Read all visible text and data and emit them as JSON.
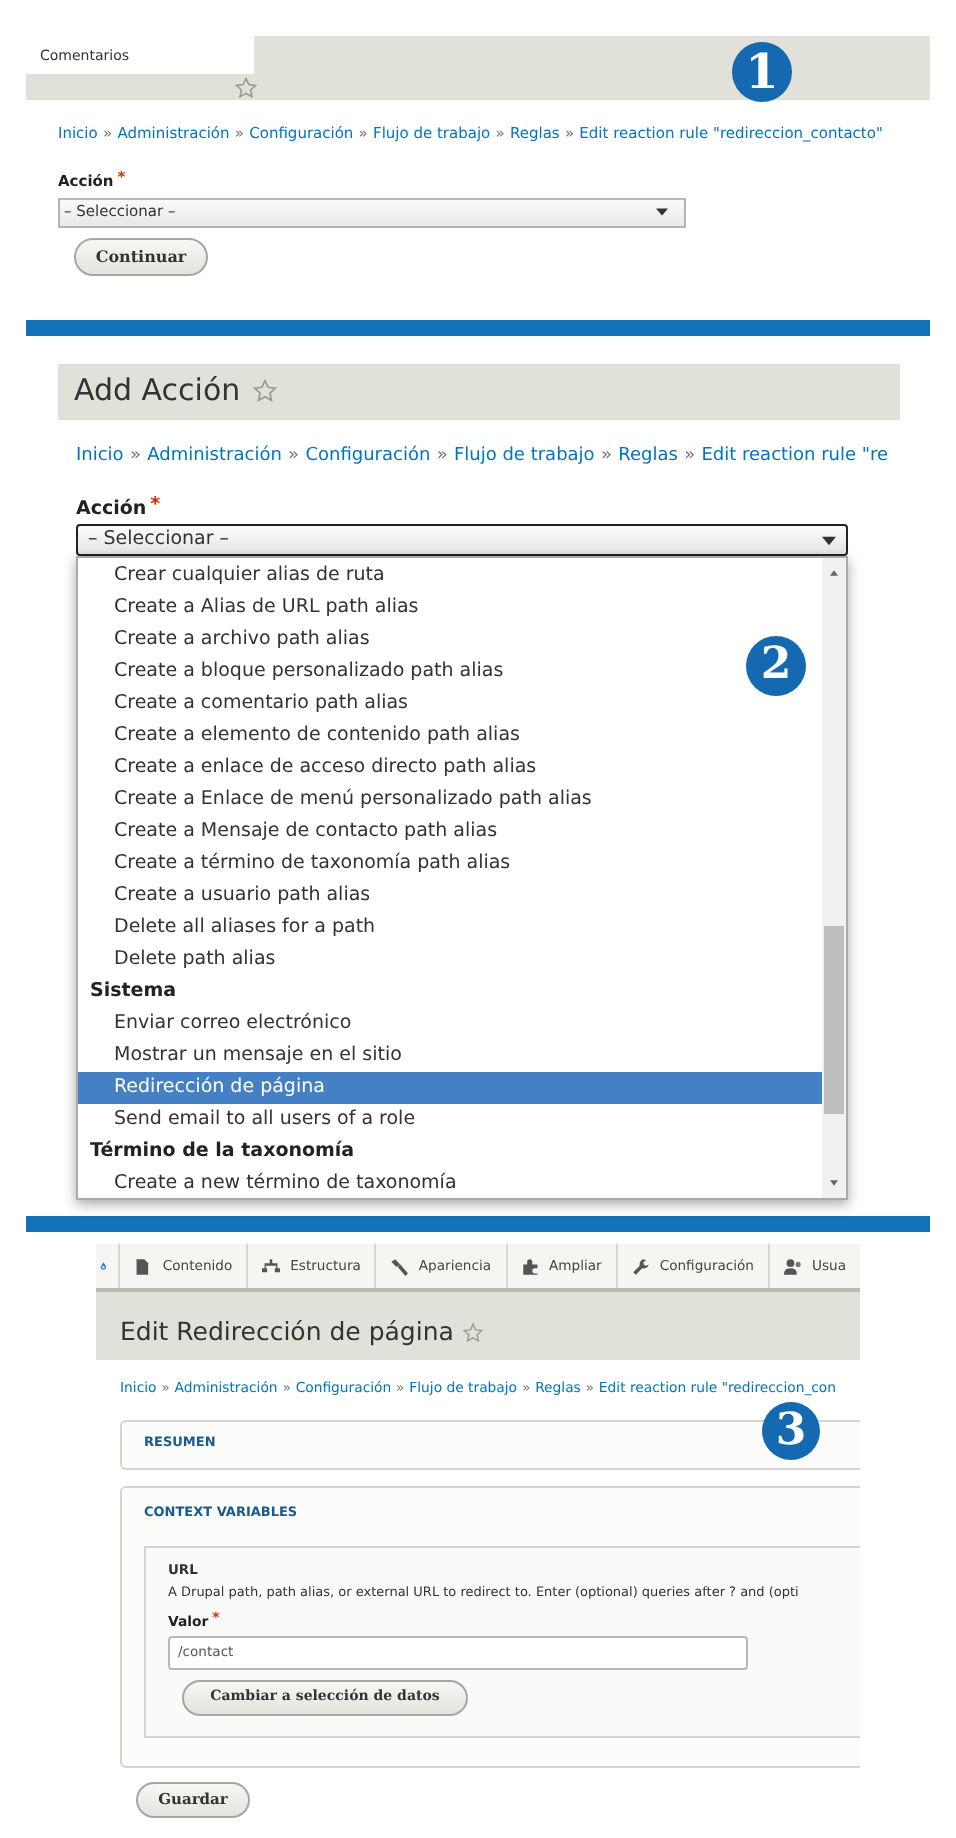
{
  "panel_1": {
    "tab": "Comentarios",
    "badge": "1",
    "breadcrumb": [
      "Inicio",
      "Administración",
      "Configuración",
      "Flujo de trabajo",
      "Reglas",
      "Edit reaction rule \"redireccion_contacto\""
    ],
    "separator": "»",
    "field_label": "Acción",
    "required_mark": "*",
    "select_value": "– Seleccionar –",
    "button": "Continuar"
  },
  "panel_2": {
    "title": "Add Acción",
    "badge": "2",
    "breadcrumb": [
      "Inicio",
      "Administración",
      "Configuración",
      "Flujo de trabajo",
      "Reglas",
      "Edit reaction rule \"re"
    ],
    "separator": "»",
    "field_label": "Acción",
    "required_mark": "*",
    "select_value": "– Seleccionar –",
    "options": [
      {
        "kind": "option",
        "label": "Crear cualquier alias de ruta",
        "selected": false
      },
      {
        "kind": "option",
        "label": "Create a Alias de URL path alias",
        "selected": false
      },
      {
        "kind": "option",
        "label": "Create a archivo path alias",
        "selected": false
      },
      {
        "kind": "option",
        "label": "Create a bloque personalizado path alias",
        "selected": false
      },
      {
        "kind": "option",
        "label": "Create a comentario path alias",
        "selected": false
      },
      {
        "kind": "option",
        "label": "Create a elemento de contenido path alias",
        "selected": false
      },
      {
        "kind": "option",
        "label": "Create a enlace de acceso directo path alias",
        "selected": false
      },
      {
        "kind": "option",
        "label": "Create a Enlace de menú personalizado path alias",
        "selected": false
      },
      {
        "kind": "option",
        "label": "Create a Mensaje de contacto path alias",
        "selected": false
      },
      {
        "kind": "option",
        "label": "Create a término de taxonomía path alias",
        "selected": false
      },
      {
        "kind": "option",
        "label": "Create a usuario path alias",
        "selected": false
      },
      {
        "kind": "option",
        "label": "Delete all aliases for a path",
        "selected": false
      },
      {
        "kind": "option",
        "label": "Delete path alias",
        "selected": false
      },
      {
        "kind": "group",
        "label": "Sistema"
      },
      {
        "kind": "option",
        "label": "Enviar correo electrónico",
        "selected": false
      },
      {
        "kind": "option",
        "label": "Mostrar un mensaje en el sitio",
        "selected": false
      },
      {
        "kind": "option",
        "label": "Redirección de página",
        "selected": true
      },
      {
        "kind": "option",
        "label": "Send email to all users of a role",
        "selected": false
      },
      {
        "kind": "group",
        "label": "Término de la taxonomía"
      },
      {
        "kind": "option",
        "label": "Create a new término de taxonomía",
        "selected": false
      }
    ]
  },
  "panel_3": {
    "toolbar": [
      {
        "kind": "page",
        "label": "Contenido"
      },
      {
        "kind": "tree",
        "label": "Estructura"
      },
      {
        "kind": "wand",
        "label": "Apariencia"
      },
      {
        "kind": "puzzle",
        "label": "Ampliar"
      },
      {
        "kind": "wrench",
        "label": "Configuración"
      },
      {
        "kind": "person",
        "label": "Usua"
      }
    ],
    "title": "Edit Redirección de página",
    "badge": "3",
    "breadcrumb": [
      "Inicio",
      "Administración",
      "Configuración",
      "Flujo de trabajo",
      "Reglas",
      "Edit reaction rule \"redireccion_con"
    ],
    "separator": "»",
    "summary": "RESUMEN",
    "context_heading": "CONTEXT VARIABLES",
    "url_label": "URL",
    "url_description": "A Drupal path, path alias, or external URL to redirect to. Enter (optional) queries after ? and (opti",
    "value_label": "Valor",
    "required_mark": "*",
    "value": "/contact",
    "switch_button": "Cambiar a selección de datos",
    "save_button": "Guardar"
  }
}
